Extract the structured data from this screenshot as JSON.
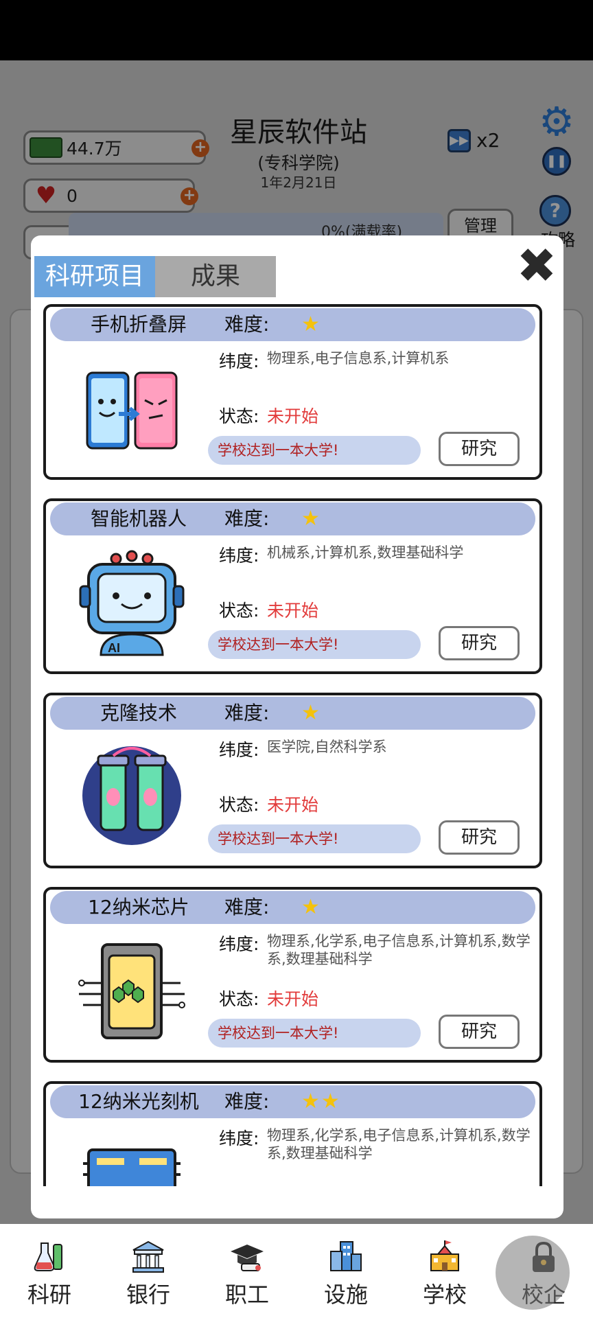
{
  "header": {
    "money": "44.7万",
    "hearts": "0",
    "school_title": "星辰软件站",
    "school_type": "(专科学院)",
    "date": "1年2月21日",
    "speed": "x2",
    "help_label": "攻略",
    "rate_label": "0%(满载率)",
    "manage_label": "管理"
  },
  "modal": {
    "tabs": [
      "科研项目",
      "成果"
    ],
    "close_glyph": "✖",
    "difficulty_label": "难度:",
    "dept_label": "纬度:",
    "state_label": "状态:",
    "research_label": "研究",
    "projects": [
      {
        "name": "手机折叠屏",
        "stars": "★",
        "depts": "物理系,电子信息系,计算机系",
        "state": "未开始",
        "requirement": "学校达到一本大学!",
        "icon": "folding-phone-icon"
      },
      {
        "name": "智能机器人",
        "stars": "★",
        "depts": "机械系,计算机系,数理基础科学",
        "state": "未开始",
        "requirement": "学校达到一本大学!",
        "icon": "robot-icon"
      },
      {
        "name": "克隆技术",
        "stars": "★",
        "depts": "医学院,自然科学系",
        "state": "未开始",
        "requirement": "学校达到一本大学!",
        "icon": "clone-tubes-icon"
      },
      {
        "name": "12纳米芯片",
        "stars": "★",
        "depts": "物理系,化学系,电子信息系,计算机系,数学系,数理基础科学",
        "state": "未开始",
        "requirement": "学校达到一本大学!",
        "icon": "chip-icon"
      },
      {
        "name": "12纳米光刻机",
        "stars": "★★",
        "depts": "物理系,化学系,电子信息系,计算机系,数学系,数理基础科学",
        "state": "",
        "requirement": "",
        "icon": "lithography-machine-icon"
      }
    ]
  },
  "nav": [
    {
      "label": "科研",
      "icon": "lab-flask-icon"
    },
    {
      "label": "银行",
      "icon": "bank-icon"
    },
    {
      "label": "职工",
      "icon": "graduate-cap-icon"
    },
    {
      "label": "设施",
      "icon": "buildings-icon"
    },
    {
      "label": "学校",
      "icon": "school-icon"
    },
    {
      "label": "校企",
      "icon": "locked-icon"
    }
  ],
  "colors": {
    "tab_active": "#6aa4de",
    "card_header": "#aebbe0",
    "star": "#f4c20d",
    "state_red": "#e23b3b"
  }
}
